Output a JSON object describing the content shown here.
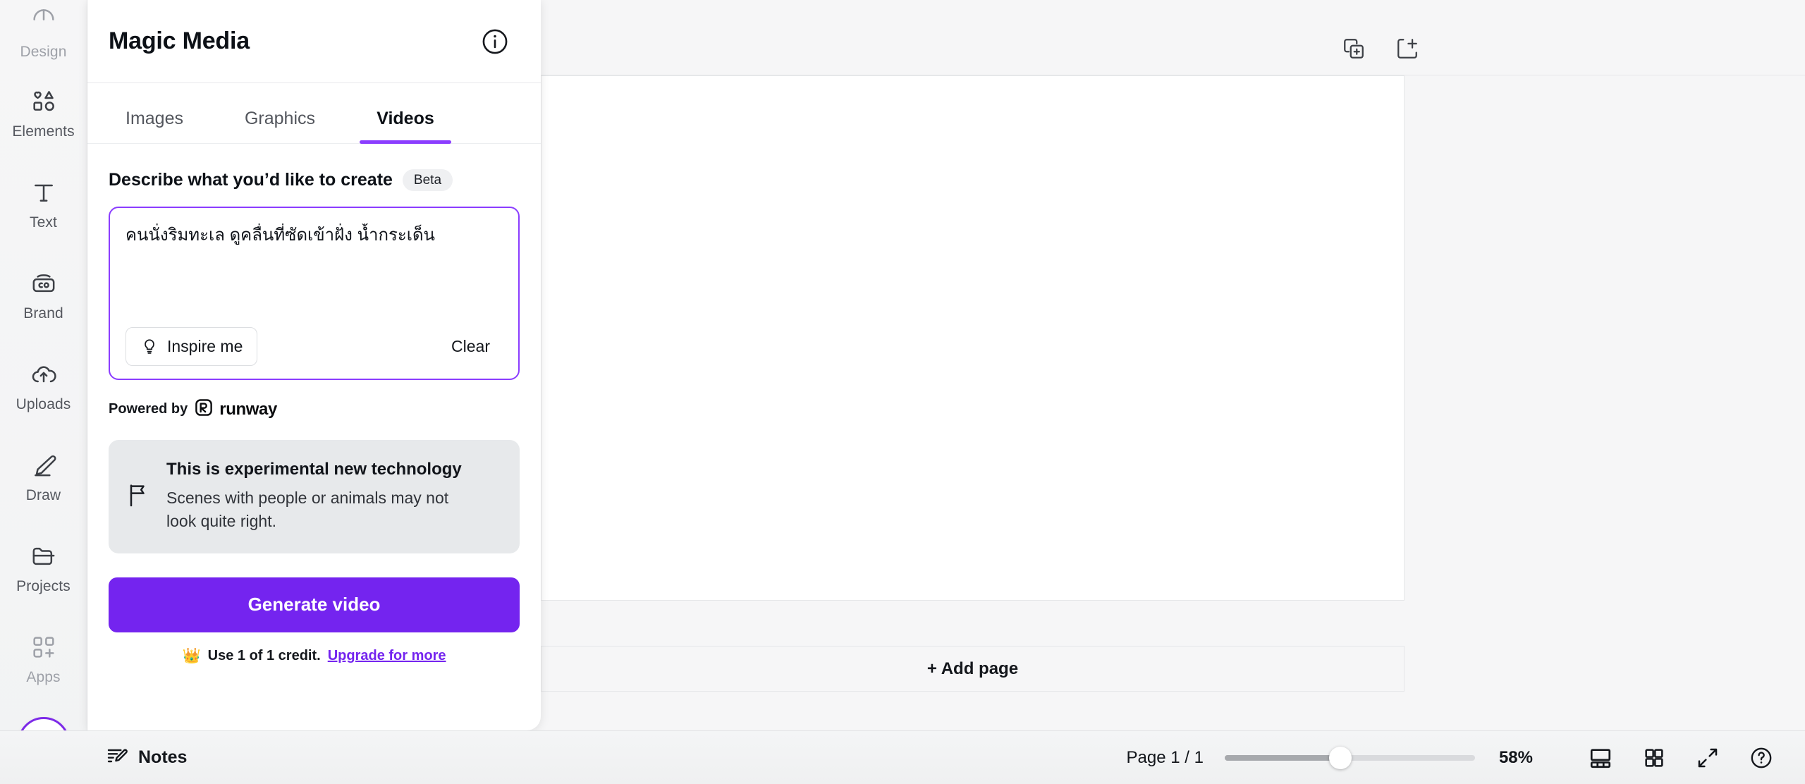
{
  "sidebar": {
    "items": [
      {
        "label": "Design",
        "icon": "design-icon",
        "dim": true
      },
      {
        "label": "Elements",
        "icon": "elements-icon",
        "dim": false
      },
      {
        "label": "Text",
        "icon": "text-icon",
        "dim": false
      },
      {
        "label": "Brand",
        "icon": "brand-icon",
        "dim": false
      },
      {
        "label": "Uploads",
        "icon": "uploads-icon",
        "dim": false
      },
      {
        "label": "Draw",
        "icon": "draw-icon",
        "dim": false
      },
      {
        "label": "Projects",
        "icon": "projects-icon",
        "dim": false
      },
      {
        "label": "Apps",
        "icon": "apps-icon",
        "dim": true
      }
    ],
    "magic_button_icon": "sparkle-icon"
  },
  "panel": {
    "title": "Magic Media",
    "info_icon": "info-circle-icon",
    "tabs": [
      {
        "label": "Images",
        "active": false
      },
      {
        "label": "Graphics",
        "active": false
      },
      {
        "label": "Videos",
        "active": true
      }
    ],
    "describe_label": "Describe what you’d like to create",
    "beta_badge": "Beta",
    "prompt_value": "คนนั่งริมทะเล ดูคลื่นที่ซัดเข้าฝั่ง น้ำกระเด็น",
    "prompt_placeholder": "Describe what you’d like to create",
    "inspire_label": "Inspire me",
    "inspire_icon": "lightbulb-icon",
    "clear_label": "Clear",
    "powered_by_label": "Powered by",
    "provider_name": "runway",
    "provider_logo_icon": "runway-logo-icon",
    "notice": {
      "icon": "flag-icon",
      "title": "This is experimental new technology",
      "body": "Scenes with people or animals may not look quite right."
    },
    "generate_label": "Generate video",
    "credit_icon": "crown-icon",
    "credit_text": "Use 1 of 1 credit.",
    "credit_link": "Upgrade for more",
    "accent_color": "#8b3dff",
    "button_color": "#7424ef"
  },
  "workspace": {
    "duplicate_page_icon": "duplicate-page-icon",
    "add_page_icon": "add-page-icon",
    "add_page_label": "+ Add page"
  },
  "bottombar": {
    "notes_label": "Notes",
    "notes_icon": "notes-pencil-icon",
    "page_indicator": "Page 1 / 1",
    "zoom_level": "58%",
    "icons": [
      {
        "name": "presenter-view-icon"
      },
      {
        "name": "grid-view-icon"
      },
      {
        "name": "fullscreen-icon"
      },
      {
        "name": "help-icon"
      }
    ]
  }
}
